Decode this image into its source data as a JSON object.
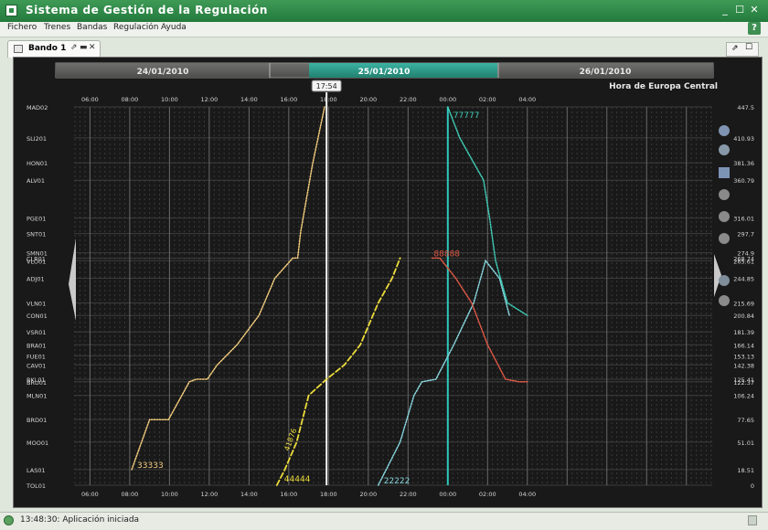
{
  "window": {
    "title": "Sistema de Gestión de la Regulación"
  },
  "menu": [
    "Fichero",
    "Trenes",
    "Bandas",
    "Regulación",
    "Ayuda"
  ],
  "document_tab": {
    "label": "Bando 1"
  },
  "date_tabs": [
    "24/01/2010",
    "25/01/2010",
    "26/01/2010"
  ],
  "current_time": "17:54",
  "timezone_label": "Hora de Europa Central",
  "colors": {
    "active_date": "#2d9b8d",
    "train_33333": "#f2cc7d",
    "train_44444": "#eedd3c",
    "train_22222": "#88d6de",
    "train_77777": "#3fcdb6",
    "train_88888": "#e25a46",
    "now_line": "#f2f2f2",
    "selected_line": "#30c9bd"
  },
  "chart_data": {
    "type": "line",
    "title": "",
    "xlabel": "Hora de Europa Central",
    "ylabel": "",
    "x_unit": "hours since 24/01/2010 00:00",
    "xlim": [
      21.2,
      53.3
    ],
    "x_ticks": [
      {
        "x": 22,
        "label": "06:00"
      },
      {
        "x": 24,
        "label": "08:00"
      },
      {
        "x": 26,
        "label": "10:00"
      },
      {
        "x": 28,
        "label": "12:00"
      },
      {
        "x": 30,
        "label": "14:00"
      },
      {
        "x": 32,
        "label": "16:00"
      },
      {
        "x": 34,
        "label": "18:00"
      },
      {
        "x": 36,
        "label": "20:00"
      },
      {
        "x": 38,
        "label": "22:00"
      },
      {
        "x": 40,
        "label": "00:00"
      },
      {
        "x": 42,
        "label": "02:00"
      },
      {
        "x": 44,
        "label": "04:00"
      }
    ],
    "ylim": [
      0,
      447.5
    ],
    "stations": [
      {
        "name": "MAD02",
        "km": 447.5
      },
      {
        "name": "SLI201",
        "km": 410.93
      },
      {
        "name": "HON01",
        "km": 381.36
      },
      {
        "name": "ALV01",
        "km": 360.79
      },
      {
        "name": "PGE01",
        "km": 316.01
      },
      {
        "name": "SNT01",
        "km": 297.7
      },
      {
        "name": "SMN01",
        "km": 274.9
      },
      {
        "name": "CLR01",
        "km": 268.74
      },
      {
        "name": "VLO01",
        "km": 265.61
      },
      {
        "name": "ADJ01",
        "km": 244.85
      },
      {
        "name": "VLN01",
        "km": 215.69
      },
      {
        "name": "CON01",
        "km": 200.84
      },
      {
        "name": "VSR01",
        "km": 181.39
      },
      {
        "name": "BRA01",
        "km": 166.14
      },
      {
        "name": "FUE01",
        "km": 153.13
      },
      {
        "name": "CAV01",
        "km": 142.38
      },
      {
        "name": "BKL01",
        "km": 125.41
      },
      {
        "name": "BRU01",
        "km": 122.37
      },
      {
        "name": "MLN01",
        "km": 106.24
      },
      {
        "name": "BRD01",
        "km": 77.65
      },
      {
        "name": "MOO01",
        "km": 51.01
      },
      {
        "name": "LAS01",
        "km": 18.51
      },
      {
        "name": "TOL01",
        "km": 0
      }
    ],
    "series": [
      {
        "name": "33333",
        "style": "dotted",
        "color": "#f2cc7d",
        "x": [
          24.1,
          25.0,
          25.95,
          27.0,
          27.35,
          27.9,
          28.4,
          29.4,
          30.5,
          31.3,
          32.2,
          32.45,
          32.6,
          33.2,
          33.8
        ],
        "y": [
          18.51,
          77.65,
          77.65,
          122.37,
          125.41,
          125.41,
          142.38,
          166.14,
          200.84,
          244.85,
          268.74,
          268.74,
          300,
          380,
          447.5
        ]
      },
      {
        "name": "44444",
        "style": "dashed",
        "color": "#eedd3c",
        "x": [
          31.4,
          31.8,
          32.4,
          33.0,
          33.9,
          34.8,
          35.6,
          36.5,
          37.2,
          37.6
        ],
        "y": [
          0,
          18.51,
          51.01,
          106.24,
          125.41,
          142.38,
          166.14,
          215.69,
          244.85,
          268.74
        ]
      },
      {
        "name": "22222",
        "style": "dotted",
        "color": "#88d6de",
        "x": [
          36.5,
          36.9,
          37.6,
          38.3,
          38.7,
          39.4,
          40.3,
          41.3,
          41.9,
          42.6,
          43.1
        ],
        "y": [
          0,
          18.51,
          51.01,
          106.24,
          122.37,
          125.41,
          166.14,
          215.69,
          265.61,
          244.85,
          200.84
        ]
      },
      {
        "name": "77777",
        "style": "dotted",
        "color": "#3fcdb6",
        "x": [
          40.0,
          40.6,
          41.3,
          41.8,
          42.1,
          42.4,
          43.0,
          44.0
        ],
        "y": [
          447.5,
          410.93,
          381.36,
          360.79,
          316.01,
          265.61,
          215.69,
          200.84
        ]
      },
      {
        "name": "88888",
        "style": "dotted",
        "color": "#e25a46",
        "x": [
          39.2,
          39.6,
          40.4,
          41.2,
          42.0,
          42.9,
          43.6,
          44.0
        ],
        "y": [
          268.74,
          268.74,
          244.85,
          215.69,
          166.14,
          125.41,
          122.37,
          122.37
        ]
      }
    ],
    "train_labels": [
      "33333",
      "44444",
      "22222",
      "77777",
      "88888",
      "41876"
    ],
    "now_x": 33.9,
    "selected_x": 40.0,
    "grid": true
  }
}
